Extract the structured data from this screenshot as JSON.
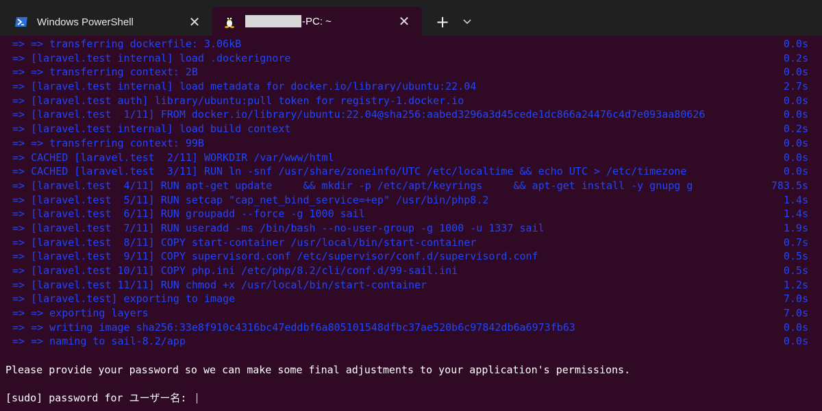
{
  "tabs": [
    {
      "title": "Windows PowerShell",
      "icon": "powershell-icon"
    },
    {
      "title_suffix": "-PC: ~",
      "icon": "linux-tux-icon"
    }
  ],
  "terminal": {
    "lines": [
      {
        "text": "=> => transferring dockerfile: 3.06kB",
        "time": "0.0s"
      },
      {
        "text": "=> [laravel.test internal] load .dockerignore",
        "time": "0.2s"
      },
      {
        "text": "=> => transferring context: 2B",
        "time": "0.0s"
      },
      {
        "text": "=> [laravel.test internal] load metadata for docker.io/library/ubuntu:22.04",
        "time": "2.7s"
      },
      {
        "text": "=> [laravel.test auth] library/ubuntu:pull token for registry-1.docker.io",
        "time": "0.0s"
      },
      {
        "text": "=> [laravel.test  1/11] FROM docker.io/library/ubuntu:22.04@sha256:aabed3296a3d45cede1dc866a24476c4d7e093aa80626",
        "time": "0.0s"
      },
      {
        "text": "=> [laravel.test internal] load build context",
        "time": "0.2s"
      },
      {
        "text": "=> => transferring context: 99B",
        "time": "0.0s"
      },
      {
        "text": "=> CACHED [laravel.test  2/11] WORKDIR /var/www/html",
        "time": "0.0s"
      },
      {
        "text": "=> CACHED [laravel.test  3/11] RUN ln -snf /usr/share/zoneinfo/UTC /etc/localtime && echo UTC > /etc/timezone",
        "time": "0.0s"
      },
      {
        "text": "=> [laravel.test  4/11] RUN apt-get update     && mkdir -p /etc/apt/keyrings     && apt-get install -y gnupg g",
        "time": "783.5s"
      },
      {
        "text": "=> [laravel.test  5/11] RUN setcap \"cap_net_bind_service=+ep\" /usr/bin/php8.2",
        "time": "1.4s"
      },
      {
        "text": "=> [laravel.test  6/11] RUN groupadd --force -g 1000 sail",
        "time": "1.4s"
      },
      {
        "text": "=> [laravel.test  7/11] RUN useradd -ms /bin/bash --no-user-group -g 1000 -u 1337 sail",
        "time": "1.9s"
      },
      {
        "text": "=> [laravel.test  8/11] COPY start-container /usr/local/bin/start-container",
        "time": "0.7s"
      },
      {
        "text": "=> [laravel.test  9/11] COPY supervisord.conf /etc/supervisor/conf.d/supervisord.conf",
        "time": "0.5s"
      },
      {
        "text": "=> [laravel.test 10/11] COPY php.ini /etc/php/8.2/cli/conf.d/99-sail.ini",
        "time": "0.5s"
      },
      {
        "text": "=> [laravel.test 11/11] RUN chmod +x /usr/local/bin/start-container",
        "time": "1.2s"
      },
      {
        "text": "=> [laravel.test] exporting to image",
        "time": "7.0s"
      },
      {
        "text": "=> => exporting layers",
        "time": "7.0s"
      },
      {
        "text": "=> => writing image sha256:33e8f910c4316bc47eddbf6a805101548dfbc37ae520b6c97842db6a6973fb63",
        "time": "0.0s"
      },
      {
        "text": "=> => naming to sail-8.2/app",
        "time": "0.0s"
      }
    ],
    "message": "Please provide your password so we can make some final adjustments to your application's permissions.",
    "prompt": "[sudo] password for ユーザー名: "
  },
  "colors": {
    "terminal_bg": "#300a24",
    "tabbar_bg": "#202020",
    "build_text": "#1f46ff",
    "plain_text": "#ffffff"
  }
}
